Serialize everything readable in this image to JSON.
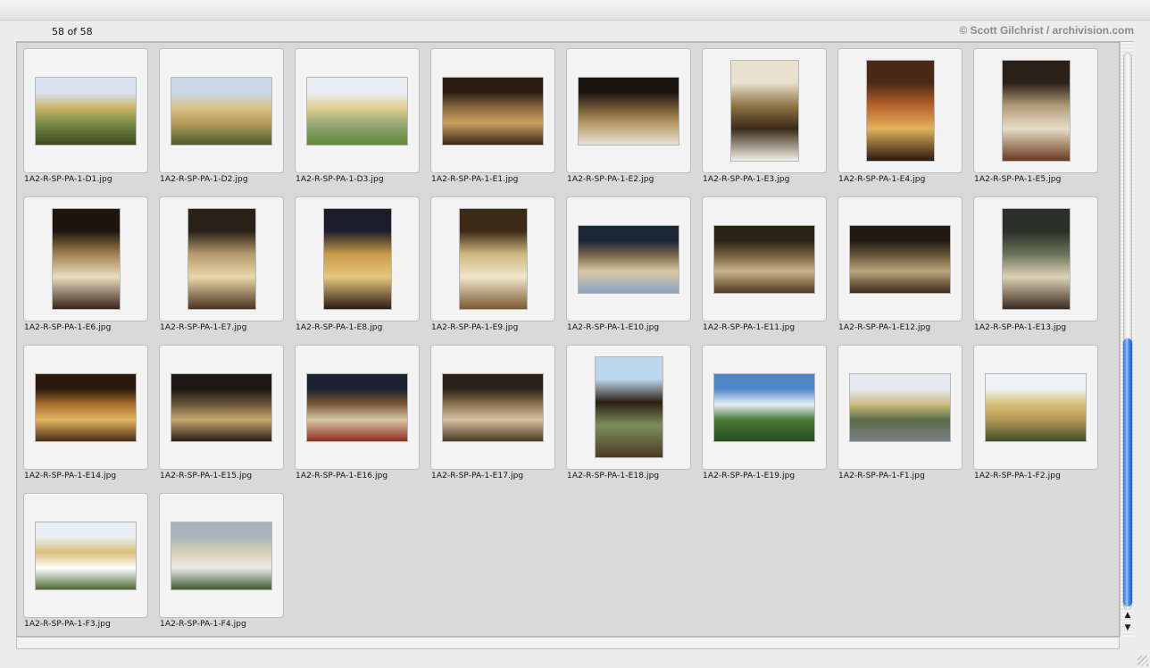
{
  "header": {
    "count_text": "58 of 58",
    "credit_text": "© Scott Gilchrist / archivision.com"
  },
  "thumbnails": [
    {
      "filename": "1A2-R-SP-PA-1-D1.jpg",
      "orientation": "landscape",
      "colors": [
        "#d9e3f2",
        "#c9b66a",
        "#7a8b45",
        "#3d4a24"
      ]
    },
    {
      "filename": "1A2-R-SP-PA-1-D2.jpg",
      "orientation": "landscape",
      "colors": [
        "#c9d6e6",
        "#d8c48a",
        "#b49a5a",
        "#4d5b2e"
      ]
    },
    {
      "filename": "1A2-R-SP-PA-1-D3.jpg",
      "orientation": "landscape",
      "colors": [
        "#e8eef5",
        "#e0cf8c",
        "#9aa878",
        "#5f8a3a"
      ]
    },
    {
      "filename": "1A2-R-SP-PA-1-E1.jpg",
      "orientation": "landscape",
      "colors": [
        "#2b1d14",
        "#8c6a3c",
        "#c9a064",
        "#3b2617"
      ]
    },
    {
      "filename": "1A2-R-SP-PA-1-E2.jpg",
      "orientation": "landscape",
      "colors": [
        "#1c1510",
        "#6e5634",
        "#b59a67",
        "#e7e2d6"
      ]
    },
    {
      "filename": "1A2-R-SP-PA-1-E3.jpg",
      "orientation": "portrait",
      "colors": [
        "#e9e1cd",
        "#8f7446",
        "#3a2a19",
        "#f2efe6"
      ]
    },
    {
      "filename": "1A2-R-SP-PA-1-E4.jpg",
      "orientation": "portrait",
      "colors": [
        "#4a2a17",
        "#b8632c",
        "#e1b25a",
        "#2a1a10"
      ]
    },
    {
      "filename": "1A2-R-SP-PA-1-E5.jpg",
      "orientation": "portrait",
      "colors": [
        "#2b2118",
        "#b09a77",
        "#e6ddc9",
        "#6a3a1e"
      ]
    },
    {
      "filename": "1A2-R-SP-PA-1-E6.jpg",
      "orientation": "portrait",
      "colors": [
        "#1f150f",
        "#a2804f",
        "#e9ddc1",
        "#3a2418"
      ]
    },
    {
      "filename": "1A2-R-SP-PA-1-E7.jpg",
      "orientation": "portrait",
      "colors": [
        "#2a2118",
        "#b59a6d",
        "#e9d8a8",
        "#4b3420"
      ]
    },
    {
      "filename": "1A2-R-SP-PA-1-E8.jpg",
      "orientation": "portrait",
      "colors": [
        "#1b1e2a",
        "#c89a4a",
        "#e7c77b",
        "#2c1d13"
      ]
    },
    {
      "filename": "1A2-R-SP-PA-1-E9.jpg",
      "orientation": "portrait",
      "colors": [
        "#3b2a18",
        "#cfb77d",
        "#efe6cb",
        "#7b5a33"
      ]
    },
    {
      "filename": "1A2-R-SP-PA-1-E10.jpg",
      "orientation": "landscape",
      "colors": [
        "#1b2638",
        "#7d6b4f",
        "#d9c9a3",
        "#8aa2c2"
      ]
    },
    {
      "filename": "1A2-R-SP-PA-1-E11.jpg",
      "orientation": "landscape",
      "colors": [
        "#2d2217",
        "#7a6444",
        "#c9b48a",
        "#50381f"
      ]
    },
    {
      "filename": "1A2-R-SP-PA-1-E12.jpg",
      "orientation": "landscape",
      "colors": [
        "#1f1a13",
        "#6c5a3d",
        "#bba47b",
        "#3a2c1c"
      ]
    },
    {
      "filename": "1A2-R-SP-PA-1-E13.jpg",
      "orientation": "portrait",
      "colors": [
        "#2a2f28",
        "#6a725a",
        "#dcd3b8",
        "#3b2b1e"
      ]
    },
    {
      "filename": "1A2-R-SP-PA-1-E14.jpg",
      "orientation": "landscape",
      "colors": [
        "#2a1a0e",
        "#a86f2c",
        "#e2b462",
        "#4a2d17"
      ]
    },
    {
      "filename": "1A2-R-SP-PA-1-E15.jpg",
      "orientation": "landscape",
      "colors": [
        "#1e1812",
        "#6a5538",
        "#c7a871",
        "#2a1d13"
      ]
    },
    {
      "filename": "1A2-R-SP-PA-1-E16.jpg",
      "orientation": "landscape",
      "colors": [
        "#1c2230",
        "#7b5a39",
        "#d8c7a6",
        "#8c2e22"
      ]
    },
    {
      "filename": "1A2-R-SP-PA-1-E17.jpg",
      "orientation": "landscape",
      "colors": [
        "#2a2218",
        "#8b7453",
        "#d4c2a0",
        "#4d3a26"
      ]
    },
    {
      "filename": "1A2-R-SP-PA-1-E18.jpg",
      "orientation": "portrait",
      "colors": [
        "#bcd7ee",
        "#2d1f16",
        "#7a8f57",
        "#4f3a2a"
      ]
    },
    {
      "filename": "1A2-R-SP-PA-1-E19.jpg",
      "orientation": "landscape",
      "colors": [
        "#4c86c7",
        "#e7eef7",
        "#4b7c36",
        "#244c1e"
      ]
    },
    {
      "filename": "1A2-R-SP-PA-1-F1.jpg",
      "orientation": "landscape",
      "colors": [
        "#e3e9ee",
        "#cdbb7e",
        "#5a6b45",
        "#7b7f86"
      ]
    },
    {
      "filename": "1A2-R-SP-PA-1-F2.jpg",
      "orientation": "landscape",
      "colors": [
        "#eef2f5",
        "#d7bf77",
        "#b69954",
        "#3c4f2b"
      ]
    },
    {
      "filename": "1A2-R-SP-PA-1-F3.jpg",
      "orientation": "landscape",
      "colors": [
        "#e8eef4",
        "#d8be75",
        "#ffffff",
        "#4d6a34"
      ]
    },
    {
      "filename": "1A2-R-SP-PA-1-F4.jpg",
      "orientation": "landscape",
      "colors": [
        "#a9b2bd",
        "#d9d1b6",
        "#eaeaea",
        "#3f5a35"
      ]
    }
  ]
}
